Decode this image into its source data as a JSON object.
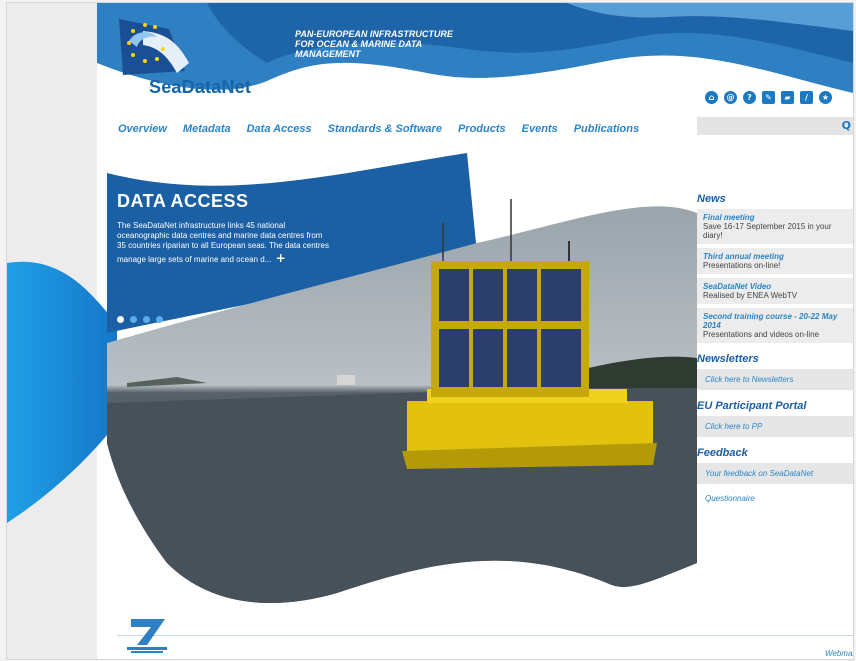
{
  "header": {
    "brand": "SeaDataNet",
    "tagline": [
      "PAN-EUROPEAN INFRASTRUCTURE",
      "FOR OCEAN & MARINE DATA",
      "MANAGEMENT"
    ]
  },
  "toolbar_icons": [
    {
      "icon": "home-icon",
      "glyph": "⌂"
    },
    {
      "icon": "at-icon",
      "glyph": "@"
    },
    {
      "icon": "help-icon",
      "glyph": "?"
    },
    {
      "icon": "tools-icon",
      "glyph": "✎"
    },
    {
      "icon": "chat-icon",
      "glyph": "▰"
    },
    {
      "icon": "pencil-icon",
      "glyph": "/"
    },
    {
      "icon": "star-icon",
      "glyph": "★"
    }
  ],
  "nav": [
    {
      "label": "Overview"
    },
    {
      "label": "Metadata"
    },
    {
      "label": "Data Access"
    },
    {
      "label": "Standards & Software"
    },
    {
      "label": "Products"
    },
    {
      "label": "Events"
    },
    {
      "label": "Publications"
    }
  ],
  "search": {
    "icon": "search-icon",
    "glyph": "Q"
  },
  "hero": {
    "title": "DATA ACCESS",
    "text": "The SeaDataNet infrastructure links 45 national oceanographic data centres and marine data centres from 35 countries riparian to all European seas. The data centres manage large sets of marine and ocean d...",
    "more": "+"
  },
  "sidebar": {
    "news_heading": "News",
    "news": [
      {
        "title": "Final meeting",
        "desc": "Save 16-17 September 2015 in your diary!"
      },
      {
        "title": "Third annual meeting",
        "desc": "Presentations on-line!"
      },
      {
        "title": "SeaDataNet Video",
        "desc": "Realised by ENEA WebTV"
      },
      {
        "title": "Second training course - 20-22 May 2014",
        "desc": "Presentations and videos on-line"
      }
    ],
    "newsletters_heading": "Newsletters",
    "newsletters_link": "Click here to Newsletters",
    "portal_heading": "EU Participant Portal",
    "portal_link": "Click here to PP",
    "feedback_heading": "Feedback",
    "feedback_link": "Your feedback on SeaDataNet",
    "questionnaire_link": "Questionnaire"
  },
  "footer": {
    "link": "Webmaster"
  }
}
